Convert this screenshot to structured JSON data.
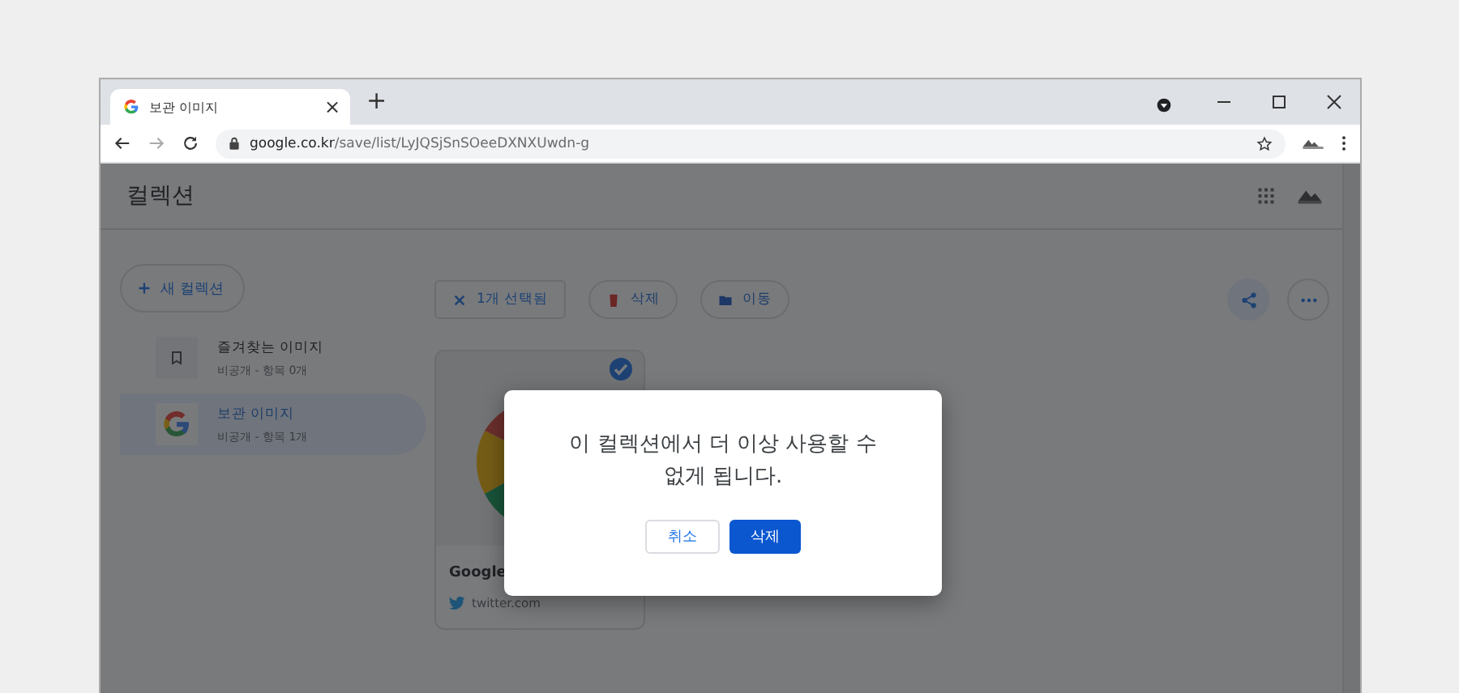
{
  "browser": {
    "tab": {
      "title": "보관 이미지",
      "close": "×"
    },
    "new_tab": "+",
    "address": {
      "domain": "google.co.kr",
      "path": "/save/list/LyJQSjSnSOeeDXNXUwdn-g"
    }
  },
  "header": {
    "title": "컬렉션"
  },
  "sidebar": {
    "new_button": "새 컬렉션",
    "items": [
      {
        "title": "즐겨찾는 이미지",
        "subtitle": "비공개 - 항목 0개",
        "kind": "bookmark",
        "selected": false
      },
      {
        "title": "보관 이미지",
        "subtitle": "비공개 - 항목 1개",
        "kind": "google",
        "selected": true
      }
    ]
  },
  "toolbar": {
    "selection": "1개 선택됨",
    "delete": "삭제",
    "move": "이동"
  },
  "card": {
    "checked": true,
    "kind": "picture",
    "title": "Google",
    "source": "twitter.com"
  },
  "dialog": {
    "message": "이 컬렉션에서 더 이상 사용할 수 없게 됩니다.",
    "cancel": "취소",
    "confirm": "삭제"
  }
}
